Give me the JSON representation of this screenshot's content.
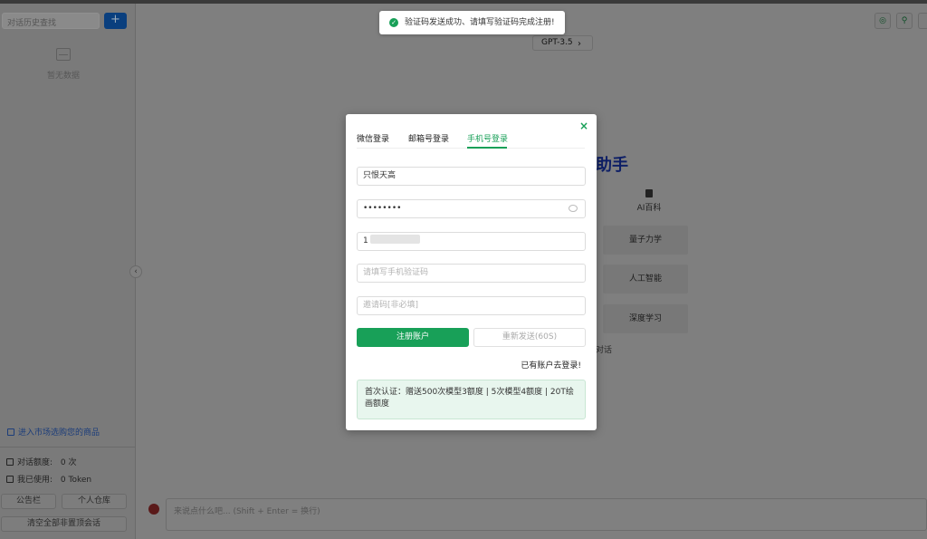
{
  "sidebar": {
    "search_placeholder": "对话历史查找",
    "add_label": "+",
    "empty_text": "暂无数据",
    "market_link": "进入市场选购您的商品",
    "stats": {
      "quota_label": "对话额度:",
      "quota_value": "0 次",
      "used_label": "我已使用:",
      "used_value": "0 Token"
    },
    "buttons": {
      "notice": "公告栏",
      "warehouse": "个人仓库",
      "clear": "清空全部非置顶会话"
    }
  },
  "main": {
    "model": "GPT-3.5",
    "title_fragment": "助手",
    "ai_label": "AI百科",
    "cards": [
      "量子力学",
      "人工智能",
      "深度学习"
    ],
    "side_text": "对话",
    "input_placeholder": "来说点什么吧... (Shift + Enter = 换行)"
  },
  "toast": {
    "message": "验证码发送成功、请填写验证码完成注册!"
  },
  "modal": {
    "close": "×",
    "tabs": [
      "微信登录",
      "邮箱号登录",
      "手机号登录"
    ],
    "active_tab": 2,
    "fields": {
      "username": "只恨天高",
      "password": "••••••••",
      "phone_prefix": "1",
      "code_placeholder": "请填写手机验证码",
      "invite_placeholder": "邀请码[非必填]"
    },
    "register_button": "注册账户",
    "resend_button": "重新发送(60S)",
    "have_account": "已有账户去登录!",
    "promo": "首次认证：赠送500次模型3额度 | 5次模型4额度 | 20T绘画额度"
  },
  "colors": {
    "accent_green": "#18a058",
    "overlay": "#7f7f7f"
  }
}
